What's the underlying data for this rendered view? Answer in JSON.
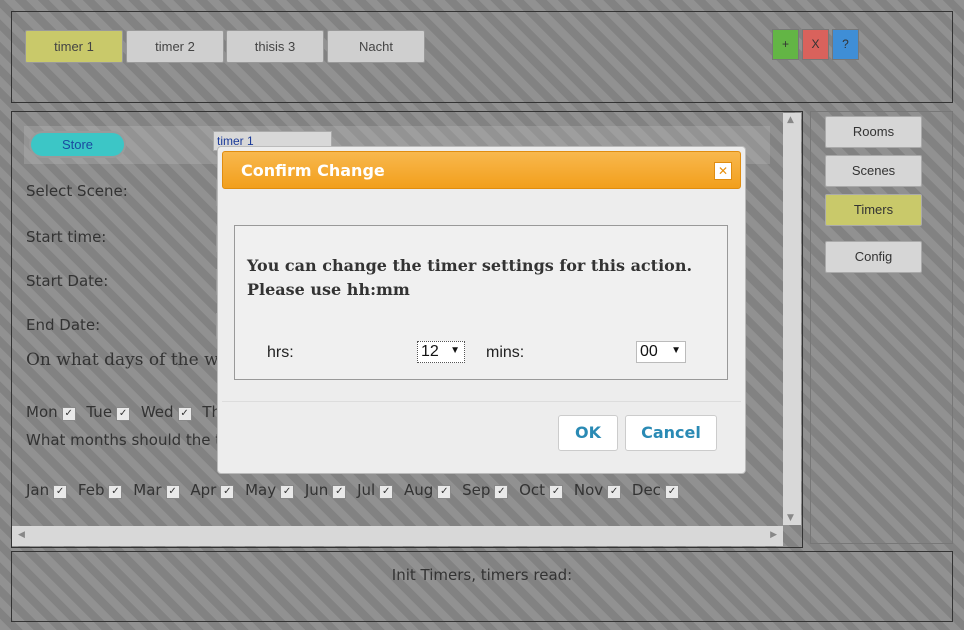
{
  "top_tabs": [
    {
      "label": "timer 1",
      "active": true
    },
    {
      "label": "timer 2",
      "active": false
    },
    {
      "label": "thisis 3",
      "active": false
    },
    {
      "label": "Nacht",
      "active": false
    }
  ],
  "action_buttons": {
    "add": "+",
    "remove": "X",
    "help": "?"
  },
  "colors": {
    "add": "#63b545",
    "remove": "#d9625c",
    "help": "#3f8ed6",
    "active_tab": "#c9c96a",
    "store": "#3cc6c6",
    "modal_header": "#f3a52a"
  },
  "right_nav": [
    {
      "label": "Rooms",
      "active": false
    },
    {
      "label": "Scenes",
      "active": false
    },
    {
      "label": "Timers",
      "active": true
    },
    {
      "label": "Config",
      "active": false
    }
  ],
  "form": {
    "store_label": "Store",
    "timer_name_value": "timer 1",
    "select_scene_label": "Select Scene:",
    "start_time_label": "Start time:",
    "start_date_label": "Start Date:",
    "end_date_label": "End Date:",
    "days_question": "On what days of the wee",
    "days": [
      "Mon",
      "Tue",
      "Wed",
      "Th"
    ],
    "months_question": "What months should the t",
    "months": [
      "Jan",
      "Feb",
      "Mar",
      "Apr",
      "May",
      "Jun",
      "Jul",
      "Aug",
      "Sep",
      "Oct",
      "Nov",
      "Dec"
    ]
  },
  "status": {
    "text": "Init Timers, timers read:"
  },
  "dialog": {
    "title": "Confirm Change",
    "close_icon": "close-icon",
    "message_line1": "You can change the timer settings for this action.",
    "message_line2": "Please use hh:mm",
    "hrs_label": "hrs:",
    "hrs_value": "12",
    "mins_label": "mins:",
    "mins_value": "00",
    "ok_label": "OK",
    "cancel_label": "Cancel"
  }
}
